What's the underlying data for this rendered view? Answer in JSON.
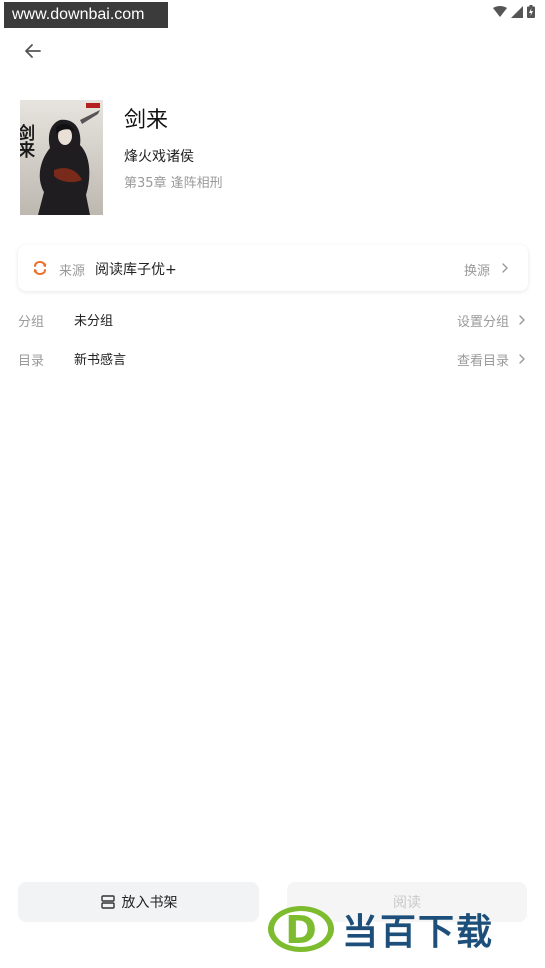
{
  "status_bar": {
    "watermark": "www.downbai.com",
    "icons": [
      "wifi-icon",
      "signal-icon",
      "battery-icon"
    ]
  },
  "header": {
    "back_icon": "arrow-left-icon"
  },
  "book": {
    "title": "剑来",
    "author": "烽火戏诸侯",
    "latest_chapter": "第35章 逢阵相刑",
    "cover_title": "剑来"
  },
  "source": {
    "label": "来源",
    "name": "阅读库子优+",
    "switch_label": "换源",
    "accent_color": "#e8722c"
  },
  "rows": [
    {
      "label": "分组",
      "value": "未分组",
      "action": "设置分组"
    },
    {
      "label": "目录",
      "value": "新书感言",
      "action": "查看目录"
    }
  ],
  "bottom": {
    "shelf_label": "放入书架",
    "read_label": "阅读"
  },
  "watermark_bottom": {
    "text": "当百下载",
    "letter": "D"
  }
}
